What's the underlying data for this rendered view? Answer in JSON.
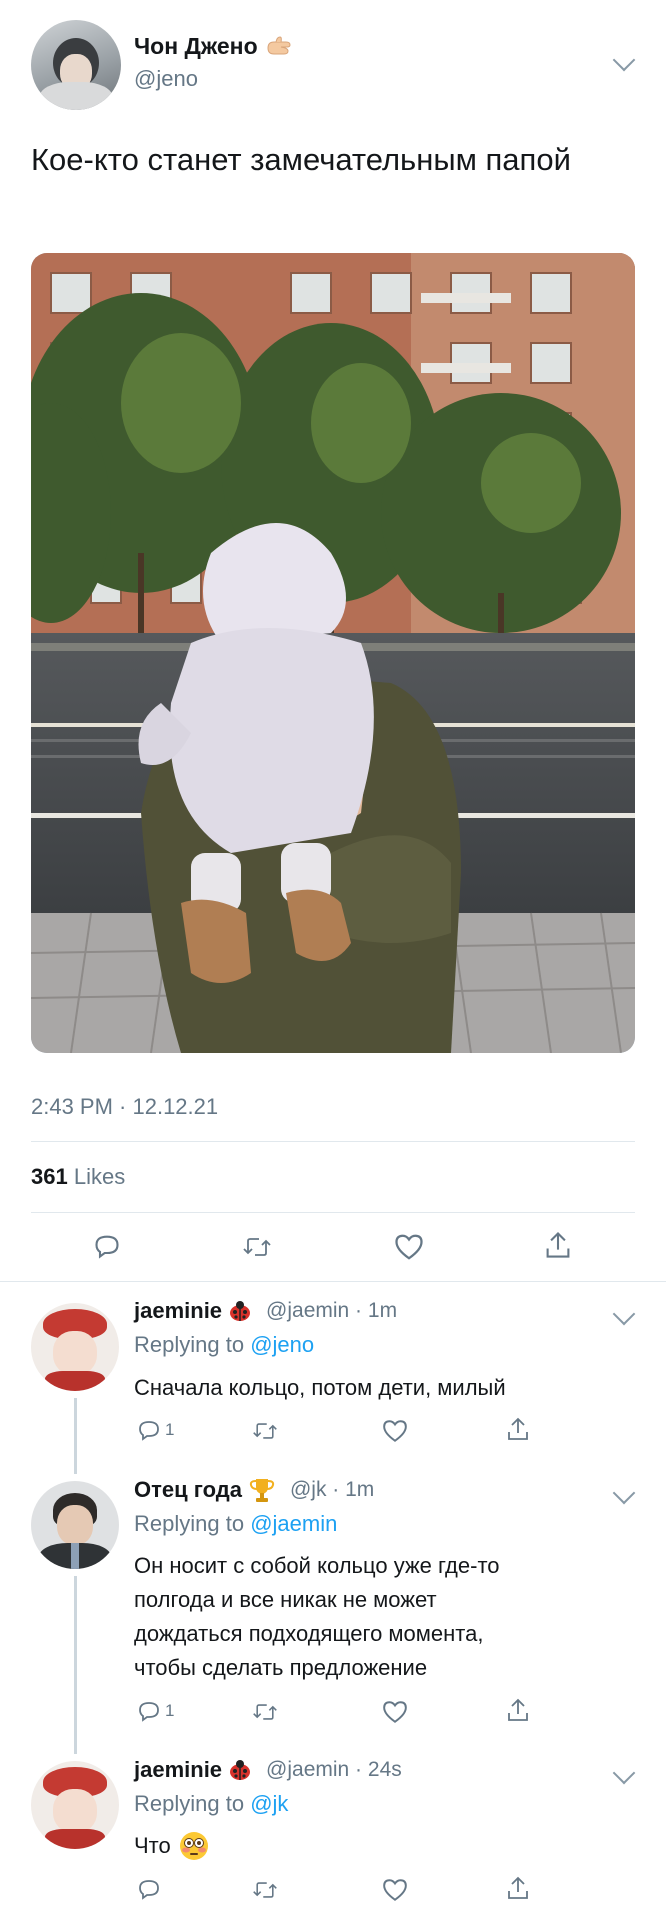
{
  "tweet": {
    "author_name": "Чон Джено",
    "author_handle": "@jeno",
    "text": "Кое-кто станет замечательным папой",
    "timestamp": "2:43 PM · 12.12.21",
    "likes_count": "361",
    "likes_label": "Likes"
  },
  "replies": [
    {
      "name": "jaeminie",
      "handle_time": "@jaemin · 1m",
      "replying_prefix": "Replying to",
      "replying_to": "@jeno",
      "text": "Сначала кольцо, потом дети, милый",
      "reply_count": "1"
    },
    {
      "name": "Отец года",
      "handle_time": "@jk · 1m",
      "replying_prefix": "Replying to",
      "replying_to": "@jaemin",
      "text_lines": [
        "Он носит с собой кольцо уже где-то",
        "полгода и все никак не может",
        "дождаться подходящего момента,",
        "чтобы сделать предложение"
      ],
      "reply_count": "1"
    },
    {
      "name": "jaeminie",
      "handle_time": "@jaemin · 24s",
      "replying_prefix": "Replying to",
      "replying_to": "@jk",
      "text": "Что",
      "reply_count": ""
    }
  ],
  "icons": {
    "reply": "reply-icon",
    "retweet": "retweet-icon",
    "like": "heart-icon",
    "share": "share-icon",
    "more": "chevron-down-icon",
    "ladybug": "ladybug-emoji",
    "trophy": "trophy-emoji",
    "flushed": "flushed-face-emoji",
    "hand": "hand-emoji"
  },
  "colors": {
    "link": "#1da1f2",
    "muted": "#657786",
    "divider": "#e1e8ed"
  }
}
